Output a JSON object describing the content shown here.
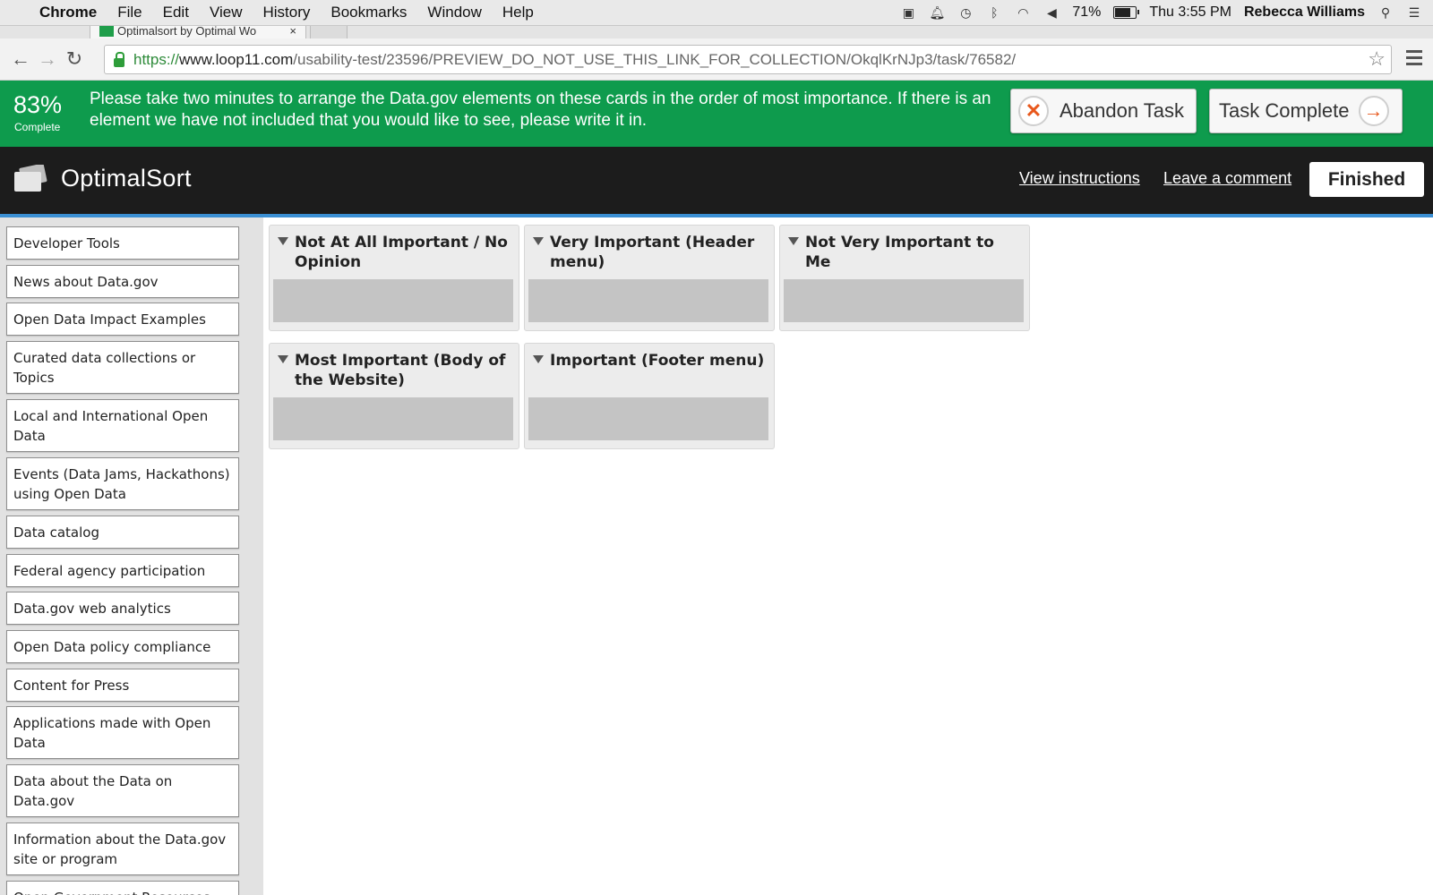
{
  "menubar": {
    "app": "Chrome",
    "items": [
      "File",
      "Edit",
      "View",
      "History",
      "Bookmarks",
      "Window",
      "Help"
    ],
    "battery": "71%",
    "clock": "Thu 3:55 PM",
    "user": "Rebecca Williams"
  },
  "tab": {
    "title": "Optimalsort by Optimal Wo",
    "close": "×"
  },
  "address": {
    "scheme": "https://",
    "host": "www.loop11.com",
    "path": "/usability-test/23596/PREVIEW_DO_NOT_USE_THIS_LINK_FOR_COLLECTION/OkqlKrNJp3/task/76582/"
  },
  "taskbar": {
    "percent": "83%",
    "percent_label": "Complete",
    "instructions": "Please take two minutes to arrange the Data.gov elements on these cards in the order of most importance. If there is an element we have not included that you would like to see, please write it in.",
    "abandon": "Abandon Task",
    "complete": "Task Complete"
  },
  "header": {
    "logo": "OptimalSort",
    "view_instructions": "View instructions",
    "leave_comment": "Leave a comment",
    "finished": "Finished"
  },
  "cards": [
    "Developer Tools",
    "News about Data.gov",
    "Open Data Impact Examples",
    "Curated data collections or Topics",
    "Local and International Open Data",
    "Events (Data Jams, Hackathons) using Open Data",
    "Data catalog",
    "Federal agency participation",
    "Data.gov web analytics",
    "Open Data policy compliance",
    "Content for Press",
    "Applications made with Open Data",
    "Data about the Data on Data.gov",
    "Information about the Data.gov site or program",
    "Open Government Resources"
  ],
  "groups": [
    "Not At All Important / No Opinion",
    "Very Important (Header menu)",
    "Not Very Important to Me",
    "Most Important (Body of the Website)",
    "Important (Footer menu)"
  ],
  "colors": {
    "task_bar": "#0e9b4d",
    "header": "#1c1c1c",
    "header_accent": "#3b8fd3",
    "abandon_icon": "#e8581c"
  }
}
